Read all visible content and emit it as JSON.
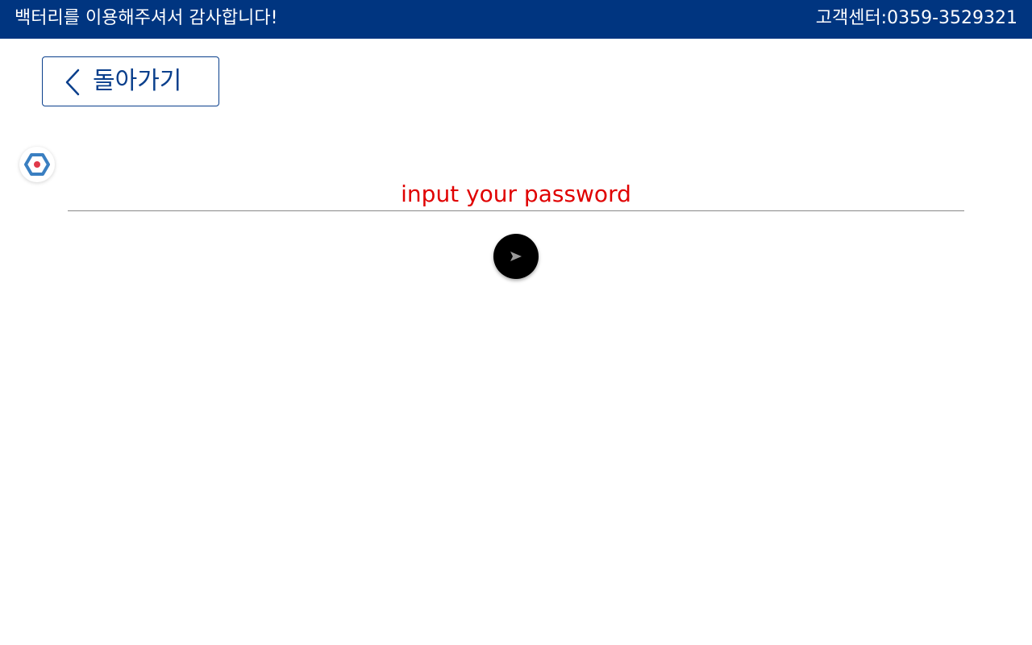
{
  "header": {
    "welcome_text": "백터리를 이용해주셔서 감사합니다!",
    "support_text": "고객센터:0359-3529321",
    "background_color": "#003580"
  },
  "back_button": {
    "icon": "chevron-left-icon",
    "label": "돌아가기",
    "color": "#0a3f8c"
  },
  "floating_widget": {
    "icon": "hexagon-logo-icon"
  },
  "password_form": {
    "input_placeholder": "input your password",
    "input_value": "",
    "placeholder_color": "#e00000",
    "submit_icon": "send-arrow-icon"
  }
}
